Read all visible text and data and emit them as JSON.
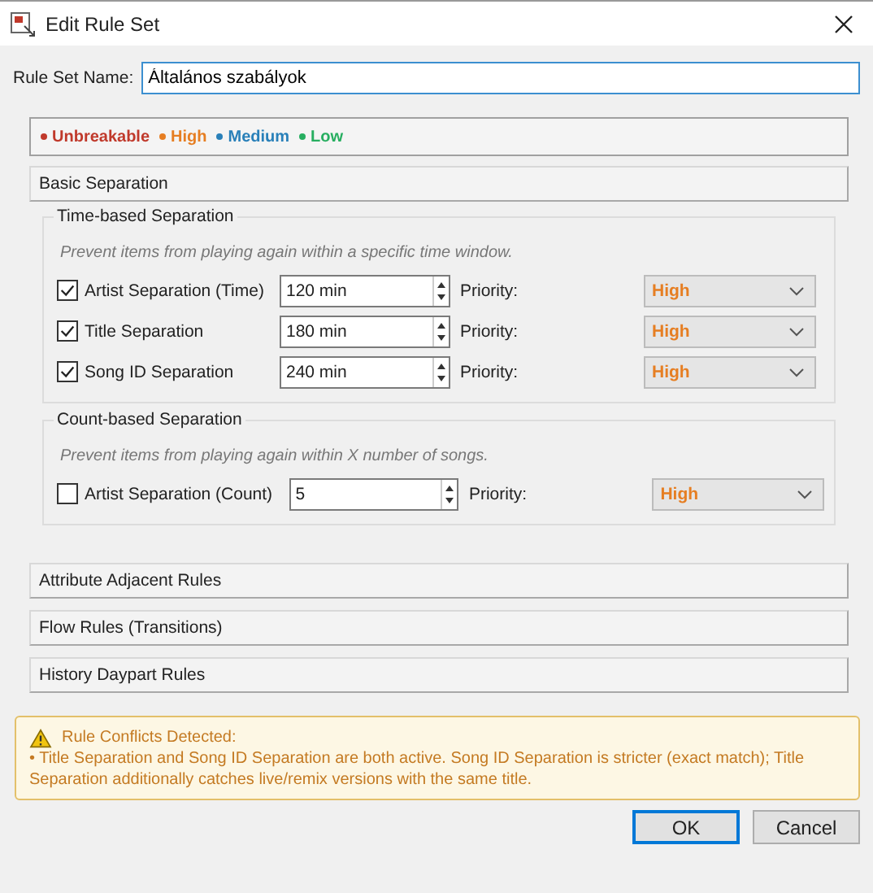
{
  "window": {
    "title": "Edit Rule Set"
  },
  "name_field": {
    "label": "Rule Set Name:",
    "value": "Általános szabályok"
  },
  "legend": [
    {
      "label": "Unbreakable",
      "color": "#c0392b"
    },
    {
      "label": "High",
      "color": "#e67e22"
    },
    {
      "label": "Medium",
      "color": "#2980b9"
    },
    {
      "label": "Low",
      "color": "#27ae60"
    }
  ],
  "sections": [
    {
      "title": "Basic Separation",
      "groups": [
        {
          "title": "Time-based Separation",
          "hint": "Prevent items from playing again within a specific time window.",
          "rules": [
            {
              "label": "Artist Separation (Time)",
              "checked": true,
              "value": "120 min",
              "priority_label": "Priority:",
              "priority": "High",
              "color": "#e67e22"
            },
            {
              "label": "Title Separation",
              "checked": true,
              "value": "180 min",
              "priority_label": "Priority:",
              "priority": "High",
              "color": "#e67e22"
            },
            {
              "label": "Song ID Separation",
              "checked": true,
              "value": "240 min",
              "priority_label": "Priority:",
              "priority": "High",
              "color": "#e67e22"
            }
          ]
        },
        {
          "title": "Count-based Separation",
          "hint": "Prevent items from playing again within X number of songs.",
          "rules": [
            {
              "label": "Artist Separation (Count)",
              "checked": false,
              "value": "5",
              "priority_label": "Priority:",
              "priority": "High",
              "color": "#e67e22"
            }
          ]
        }
      ]
    },
    {
      "title": "Attribute Adjacent Rules"
    },
    {
      "title": "Flow Rules (Transitions)"
    },
    {
      "title": "History  Daypart Rules"
    }
  ],
  "warning": {
    "title": "Rule Conflicts Detected:",
    "message": "• Title Separation and Song ID Separation are both active. Song ID Separation is stricter (exact match); Title Separation additionally catches live/remix versions with the same title."
  },
  "buttons": [
    {
      "label": "OK",
      "selected": true
    },
    {
      "label": "Cancel",
      "selected": false
    }
  ]
}
